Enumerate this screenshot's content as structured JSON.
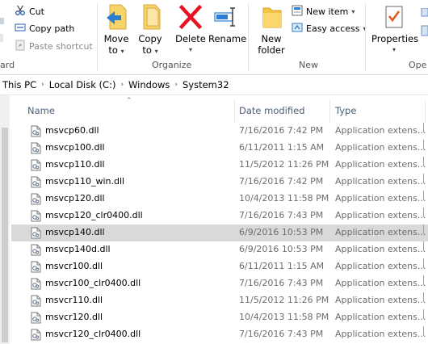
{
  "ribbon": {
    "clipboard": {
      "cut_label": "Cut",
      "copy_path_label": "Copy path",
      "paste_shortcut_label": "Paste shortcut",
      "group_label_partial": "ard"
    },
    "organize": {
      "move_to_line1": "Move",
      "move_to_line2": "to",
      "copy_to_line1": "Copy",
      "copy_to_line2": "to",
      "delete_label": "Delete",
      "rename_label": "Rename",
      "group_label": "Organize"
    },
    "new": {
      "new_folder_line1": "New",
      "new_folder_line2": "folder",
      "new_item_label": "New item",
      "easy_access_label": "Easy access",
      "group_label": "New"
    },
    "open": {
      "properties_label": "Properties",
      "group_label_partial": "Ope"
    }
  },
  "address": {
    "crumbs": [
      "This PC",
      "Local Disk (C:)",
      "Windows",
      "System32"
    ]
  },
  "columns": {
    "name": "Name",
    "date_modified": "Date modified",
    "type": "Type"
  },
  "files": [
    {
      "name": "msvcp60.dll",
      "date": "7/16/2016 7:42 PM",
      "type": "Application extens..."
    },
    {
      "name": "msvcp100.dll",
      "date": "6/11/2011 1:15 AM",
      "type": "Application extens..."
    },
    {
      "name": "msvcp110.dll",
      "date": "11/5/2012 11:26 PM",
      "type": "Application extens..."
    },
    {
      "name": "msvcp110_win.dll",
      "date": "7/16/2016 7:42 PM",
      "type": "Application extens..."
    },
    {
      "name": "msvcp120.dll",
      "date": "10/4/2013 11:58 PM",
      "type": "Application extens..."
    },
    {
      "name": "msvcp120_clr0400.dll",
      "date": "7/16/2016 7:43 PM",
      "type": "Application extens..."
    },
    {
      "name": "msvcp140.dll",
      "date": "6/9/2016 10:53 PM",
      "type": "Application extens...",
      "selected": true
    },
    {
      "name": "msvcp140d.dll",
      "date": "6/9/2016 10:53 PM",
      "type": "Application extens..."
    },
    {
      "name": "msvcr100.dll",
      "date": "6/11/2011 1:15 AM",
      "type": "Application extens..."
    },
    {
      "name": "msvcr100_clr0400.dll",
      "date": "7/16/2016 7:43 PM",
      "type": "Application extens..."
    },
    {
      "name": "msvcr110.dll",
      "date": "11/5/2012 11:26 PM",
      "type": "Application extens..."
    },
    {
      "name": "msvcr120.dll",
      "date": "10/4/2013 11:58 PM",
      "type": "Application extens..."
    },
    {
      "name": "msvcr120_clr0400.dll",
      "date": "7/16/2016 7:43 PM",
      "type": "Application extens..."
    }
  ],
  "colors": {
    "selected_row": "#d9d9d9",
    "header_text": "#4c607a",
    "delete_red": "#e81123",
    "folder_yellow": "#f5c342"
  }
}
